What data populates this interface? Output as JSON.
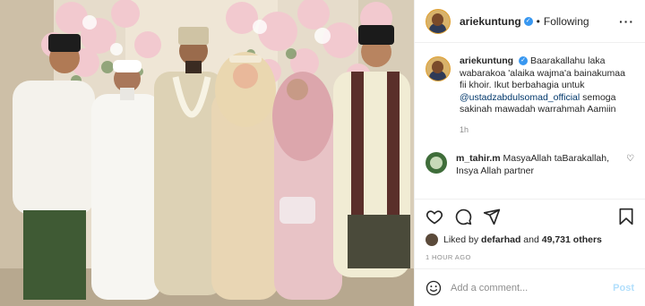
{
  "post": {
    "username": "ariekuntung",
    "follow_status": "Following",
    "caption": {
      "username": "ariekuntung",
      "text_before_mention": "Baarakallahu laka wabarakoa 'alaika wajma'a bainakumaa fii khoir. Ikut berbahagia untuk ",
      "mention": "@ustadzabdulsomad_official",
      "text_after_mention": " semoga sakinah mawadah warrahmah Aamiin",
      "time": "1h"
    },
    "comments": [
      {
        "username": "m_tahir.m",
        "text": "MasyaAllah taBarakallah, Insya Allah partner"
      }
    ],
    "likes": {
      "prefix": "Liked by",
      "user": "defarhad",
      "connector": "and",
      "count": "49,731 others"
    },
    "posted_time": "1 HOUR AGO",
    "add_comment_placeholder": "Add a comment...",
    "post_button": "Post"
  },
  "icons": {
    "verified": "verified-badge-icon",
    "more": "more-options-icon",
    "like": "heart-icon",
    "comment": "comment-icon",
    "share": "paper-plane-icon",
    "save": "bookmark-icon",
    "emoji": "smiley-icon"
  },
  "colors": {
    "verified_blue": "#3897f0",
    "mention_blue": "#00376b",
    "post_button_disabled": "#b2dffc",
    "muted_text": "#8e8e8e"
  }
}
